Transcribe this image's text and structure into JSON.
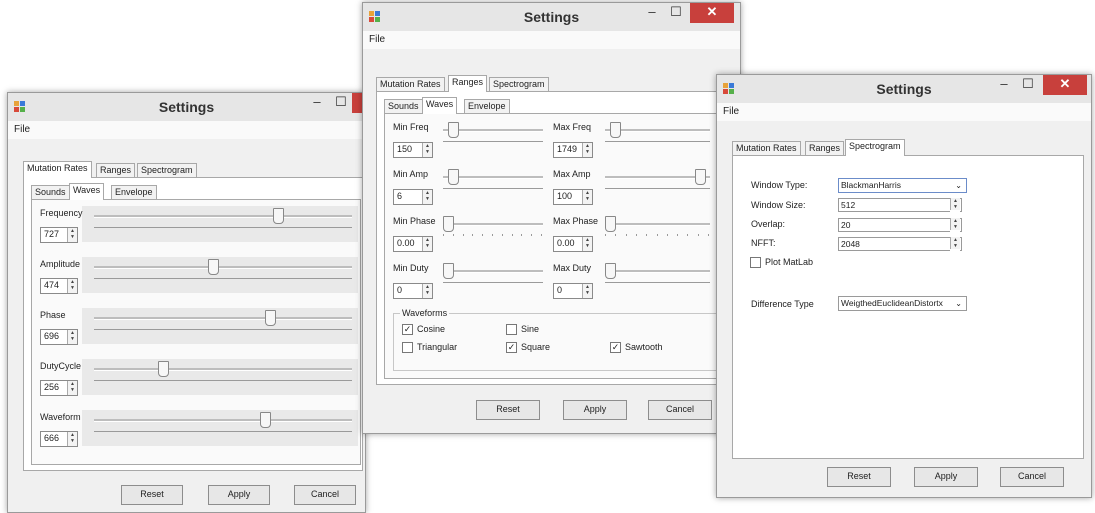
{
  "window1": {
    "title": "Settings",
    "menu_file": "File",
    "tabs": [
      "Mutation Rates",
      "Ranges",
      "Spectrogram"
    ],
    "subtabs": [
      "Sounds",
      "Waves",
      "Envelope"
    ],
    "params": [
      {
        "label": "Frequency",
        "value": "727",
        "level": 0.72
      },
      {
        "label": "Amplitude",
        "value": "474",
        "level": 0.46
      },
      {
        "label": "Phase",
        "value": "696",
        "level": 0.69
      },
      {
        "label": "DutyCycle",
        "value": "256",
        "level": 0.26
      },
      {
        "label": "Waveform",
        "value": "666",
        "level": 0.67
      }
    ],
    "buttons": {
      "reset": "Reset",
      "apply": "Apply",
      "cancel": "Cancel"
    }
  },
  "window2": {
    "title": "Settings",
    "menu_file": "File",
    "tabs": [
      "Mutation Rates",
      "Ranges",
      "Spectrogram"
    ],
    "subtabs": [
      "Sounds",
      "Waves",
      "Envelope"
    ],
    "rows": [
      {
        "left_label": "Min Freq",
        "left_value": "150",
        "left_level": 0.05,
        "right_label": "Max Freq",
        "right_value": "1749",
        "right_level": 0.05
      },
      {
        "left_label": "Min Amp",
        "left_value": "6",
        "left_level": 0.05,
        "right_label": "Max Amp",
        "right_value": "100",
        "right_level": 0.95
      },
      {
        "left_label": "Min Phase",
        "left_value": "0.00",
        "left_level": 0.0,
        "right_label": "Max Phase",
        "right_value": "0.00",
        "right_level": 0.0
      },
      {
        "left_label": "Min Duty",
        "left_value": "0",
        "left_level": 0.0,
        "right_label": "Max Duty",
        "right_value": "0",
        "right_level": 0.0
      }
    ],
    "waveforms": {
      "legend": "Waveforms",
      "items": [
        {
          "label": "Cosine",
          "checked": true
        },
        {
          "label": "Sine",
          "checked": false
        },
        {
          "label": "Triangular",
          "checked": false
        },
        {
          "label": "Square",
          "checked": true
        },
        {
          "label": "Sawtooth",
          "checked": true
        }
      ]
    },
    "buttons": {
      "reset": "Reset",
      "apply": "Apply",
      "cancel": "Cancel"
    }
  },
  "window3": {
    "title": "Settings",
    "menu_file": "File",
    "tabs": [
      "Mutation Rates",
      "Ranges",
      "Spectrogram"
    ],
    "fields": {
      "window_type_label": "Window Type:",
      "window_type_value": "BlackmanHarris",
      "window_size_label": "Window Size:",
      "window_size_value": "512",
      "overlap_label": "Overlap:",
      "overlap_value": "20",
      "nfft_label": "NFFT:",
      "nfft_value": "2048",
      "plot_matlab_label": "Plot MatLab",
      "plot_matlab_checked": false,
      "difference_type_label": "Difference Type",
      "difference_type_value": "WeigthedEuclideanDistortx"
    },
    "buttons": {
      "reset": "Reset",
      "apply": "Apply",
      "cancel": "Cancel"
    }
  }
}
